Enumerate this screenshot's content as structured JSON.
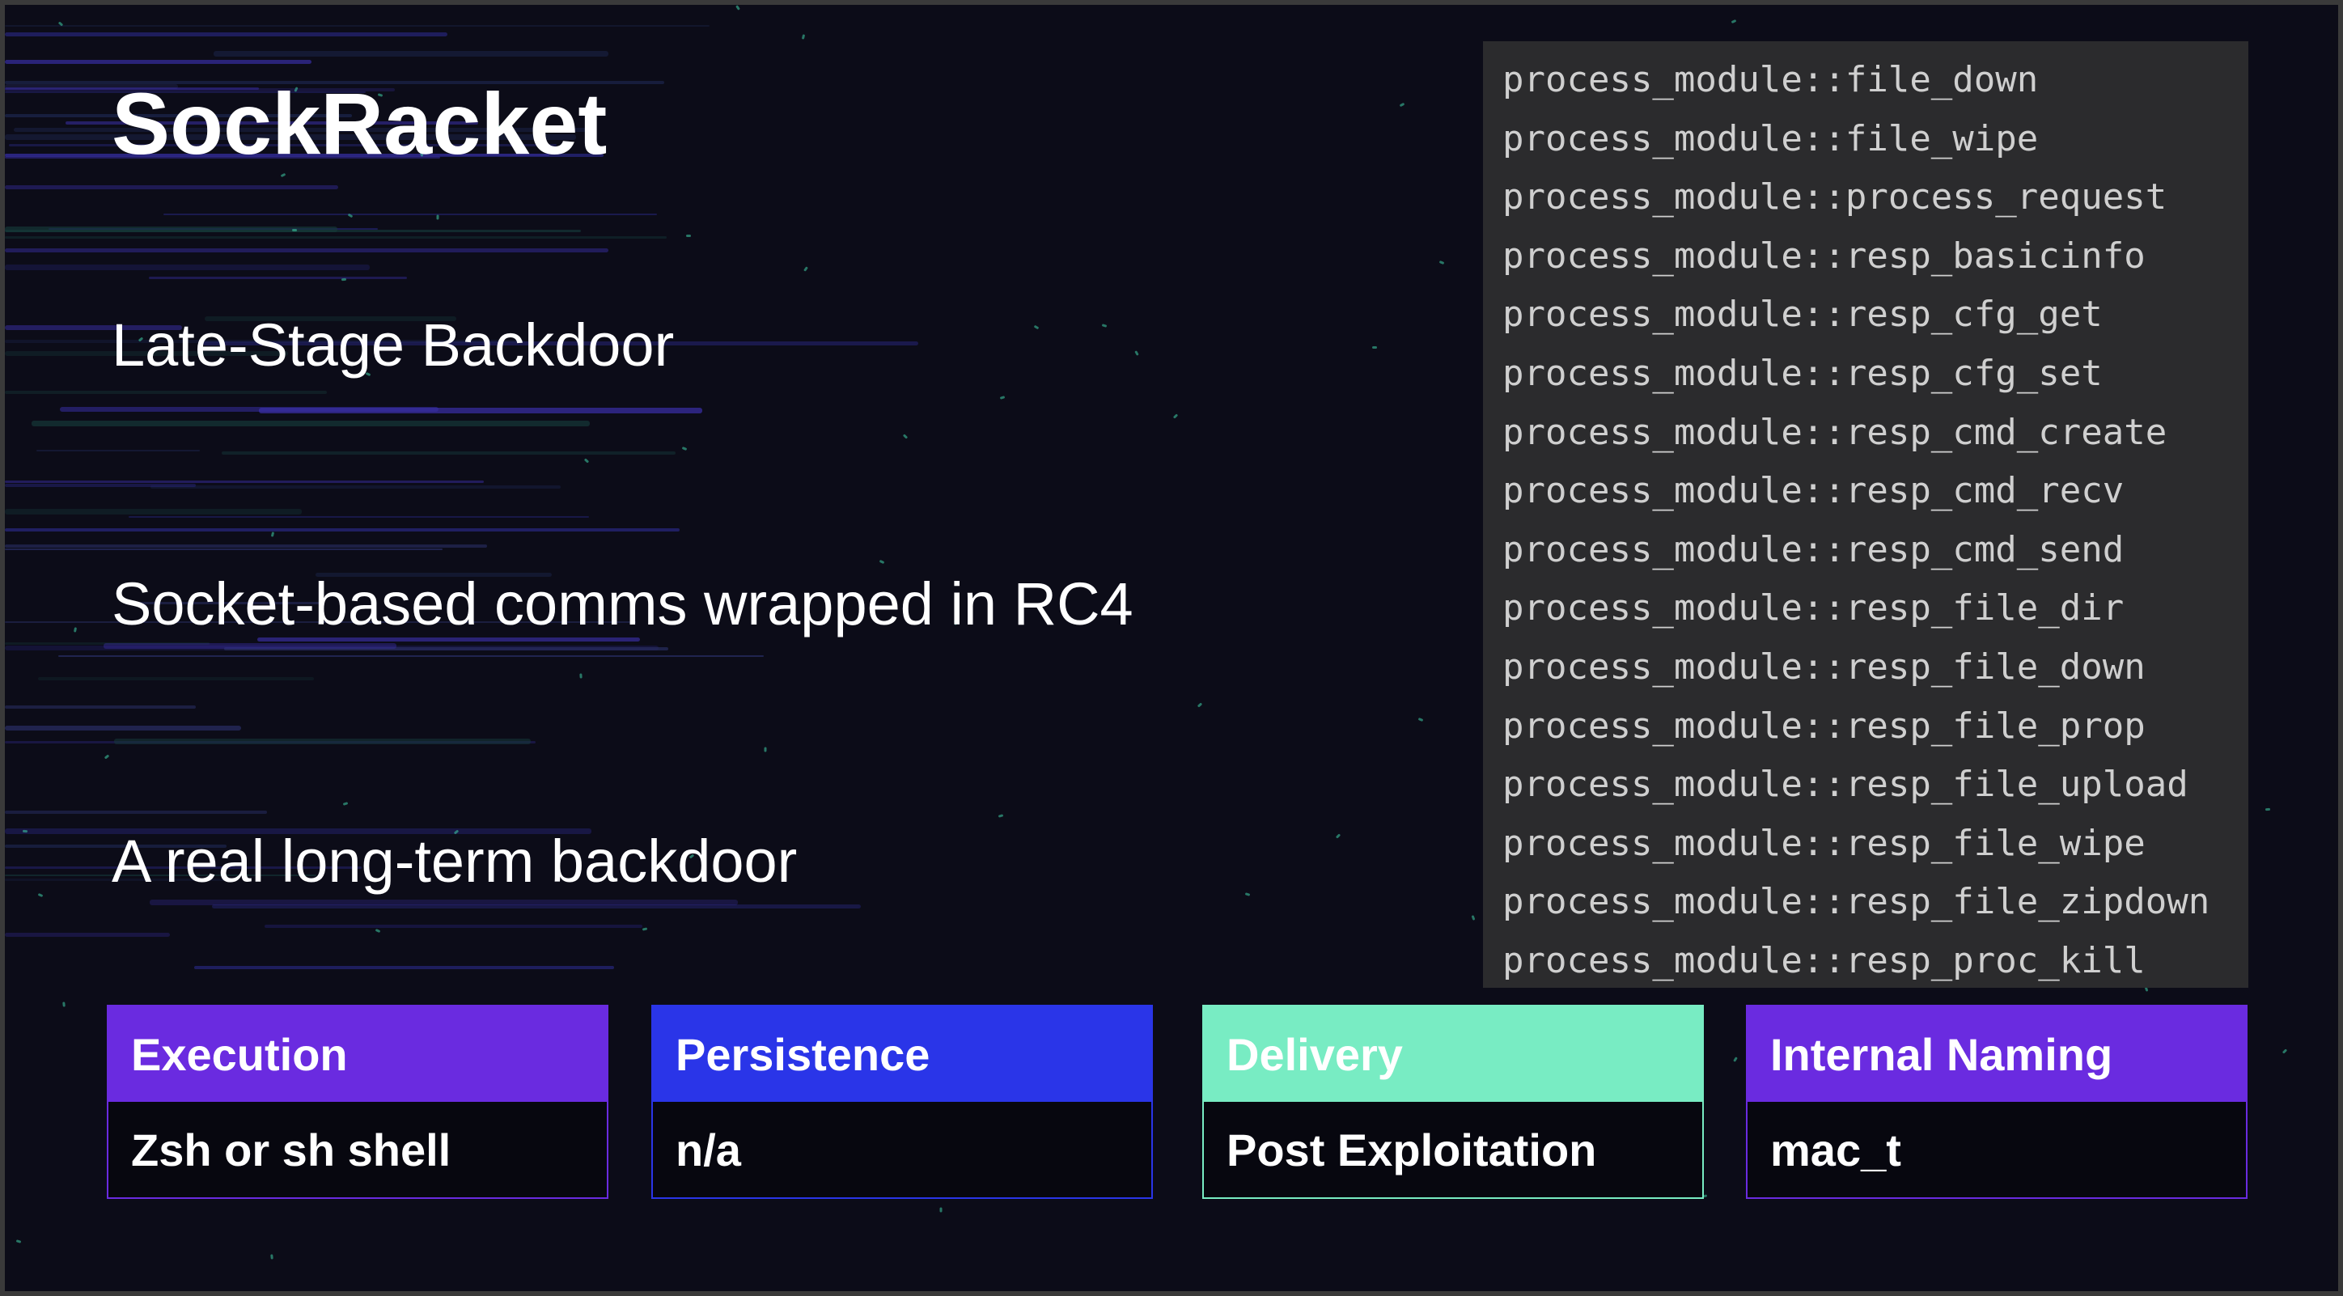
{
  "slide": {
    "title": "SockRacket",
    "bullets": [
      "Late-Stage Backdoor",
      "Socket-based comms wrapped in RC4",
      "A real long-term backdoor"
    ]
  },
  "code_panel": {
    "lines": [
      "process_module::file_down",
      "process_module::file_wipe",
      "process_module::process_request",
      "process_module::resp_basicinfo",
      "process_module::resp_cfg_get",
      "process_module::resp_cfg_set",
      "process_module::resp_cmd_create",
      "process_module::resp_cmd_recv",
      "process_module::resp_cmd_send",
      "process_module::resp_file_dir",
      "process_module::resp_file_down",
      "process_module::resp_file_prop",
      "process_module::resp_file_upload",
      "process_module::resp_file_wipe",
      "process_module::resp_file_zipdown",
      "process_module::resp_proc_kill"
    ]
  },
  "cards": [
    {
      "label": "Execution",
      "value": "Zsh or sh shell",
      "color": "#6a2be0",
      "label_color": "#ffffff"
    },
    {
      "label": "Persistence",
      "value": "n/a",
      "color": "#2a35e8",
      "label_color": "#ffffff"
    },
    {
      "label": "Delivery",
      "value": "Post Exploitation",
      "color": "#78ecc3",
      "label_color": "#ffffff"
    },
    {
      "label": "Internal Naming",
      "value": "mac_t",
      "color": "#6a2be0",
      "label_color": "#ffffff"
    }
  ]
}
